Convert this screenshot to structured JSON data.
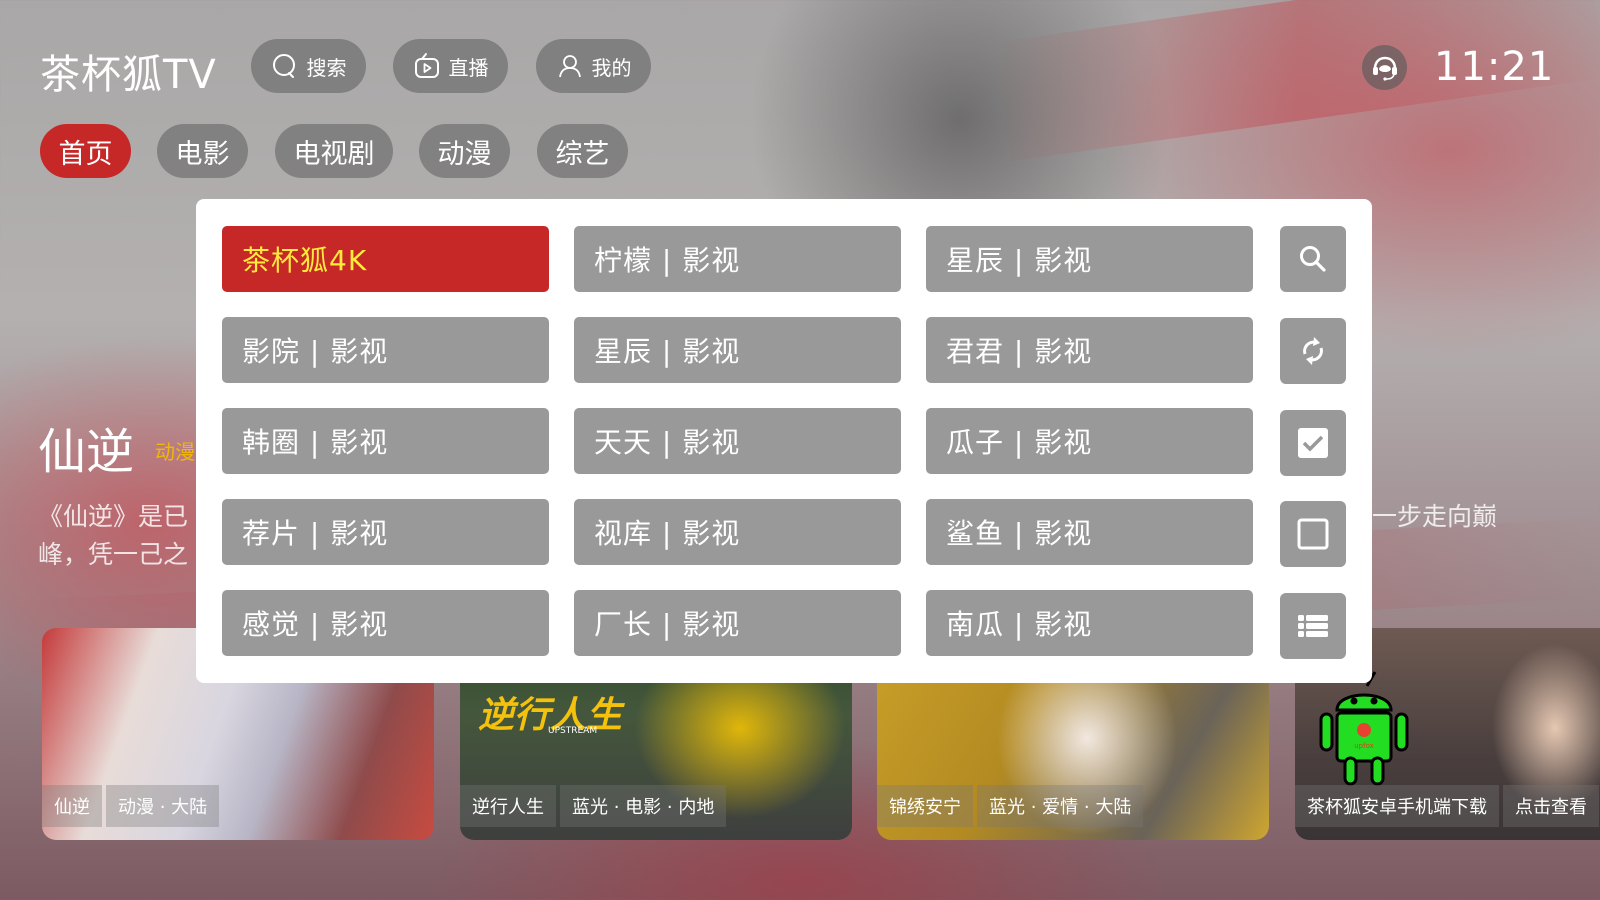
{
  "header": {
    "app_title": "茶杯狐TV",
    "actions": [
      {
        "label": "搜索",
        "icon": "search-icon"
      },
      {
        "label": "直播",
        "icon": "live-tv-icon"
      },
      {
        "label": "我的",
        "icon": "user-icon"
      }
    ],
    "support_icon": "headset-icon",
    "clock": "11:21"
  },
  "tabs": [
    {
      "label": "首页",
      "active": true
    },
    {
      "label": "电影",
      "active": false
    },
    {
      "label": "电视剧",
      "active": false
    },
    {
      "label": "动漫",
      "active": false
    },
    {
      "label": "综艺",
      "active": false
    }
  ],
  "hero": {
    "title": "仙逆",
    "tag": "动漫",
    "desc_line1_visible": "《仙逆》是已",
    "desc_line1_right_visible": "一步走向巅",
    "desc_line2_visible": "峰，凭一己之"
  },
  "cards": [
    {
      "title": "仙逆",
      "meta": "动漫 · 大陆"
    },
    {
      "title": "逆行人生",
      "meta": "蓝光 · 电影 · 内地",
      "poster_text": "逆行人生",
      "poster_subtext": "UPSTREAM"
    },
    {
      "title": "锦绣安宁",
      "meta": "蓝光 · 爱情 · 大陆"
    },
    {
      "title": "茶杯狐安卓手机端下载",
      "meta": "点击查看",
      "badge_text": "upfox"
    }
  ],
  "source_dialog": {
    "selected": "茶杯狐4K",
    "sources": [
      [
        "茶杯狐4K",
        "柠檬 | 影视",
        "星辰 | 影视"
      ],
      [
        "影院 | 影视",
        "星辰 | 影视",
        "君君 | 影视"
      ],
      [
        "韩圈 | 影视",
        "天天 | 影视",
        "瓜子 | 影视"
      ],
      [
        "荐片 | 影视",
        "视库 | 影视",
        "鲨鱼 | 影视"
      ],
      [
        "感觉 | 影视",
        "厂长 | 影视",
        "南瓜 | 影视"
      ]
    ],
    "side_actions": [
      {
        "icon": "search-icon",
        "action": "search"
      },
      {
        "icon": "refresh-icon",
        "action": "refresh"
      },
      {
        "icon": "checkbox-checked-icon",
        "action": "select-all"
      },
      {
        "icon": "checkbox-empty-icon",
        "action": "deselect-all"
      },
      {
        "icon": "list-icon",
        "action": "list-view"
      }
    ]
  },
  "colors": {
    "accent_red": "#c62828",
    "selected_text_yellow": "#ffeb3b",
    "button_gray": "#999999",
    "tag_yellow": "#f2b705"
  }
}
